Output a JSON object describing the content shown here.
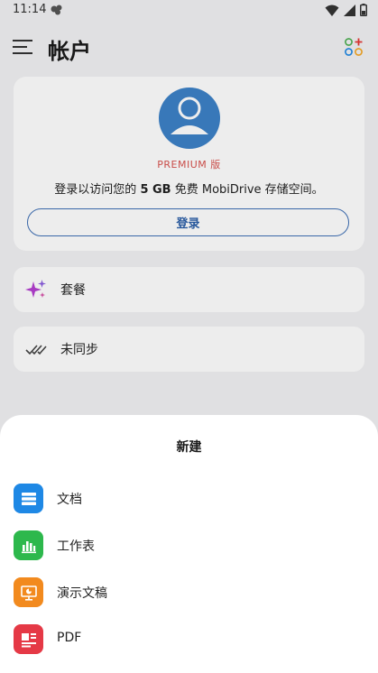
{
  "status_bar": {
    "time": "11:14"
  },
  "header": {
    "title": "帐户"
  },
  "account": {
    "premium_label": "PREMIUM 版",
    "storage_prefix": "登录以访问您的 ",
    "storage_amount": "5 GB",
    "storage_suffix": " 免费 MobiDrive 存储空间。",
    "login_label": "登录"
  },
  "list": {
    "plans_label": "套餐",
    "unsynced_label": "未同步"
  },
  "sheet": {
    "title": "新建",
    "items": [
      {
        "label": "文档",
        "color": "#1e88e5"
      },
      {
        "label": "工作表",
        "color": "#2db84c"
      },
      {
        "label": "演示文稿",
        "color": "#f28a1e"
      },
      {
        "label": "PDF",
        "color": "#e53946"
      }
    ]
  },
  "colors": {
    "accent": "#3e6fb5",
    "premium": "#d9534f",
    "avatar": "#3d82c8"
  }
}
